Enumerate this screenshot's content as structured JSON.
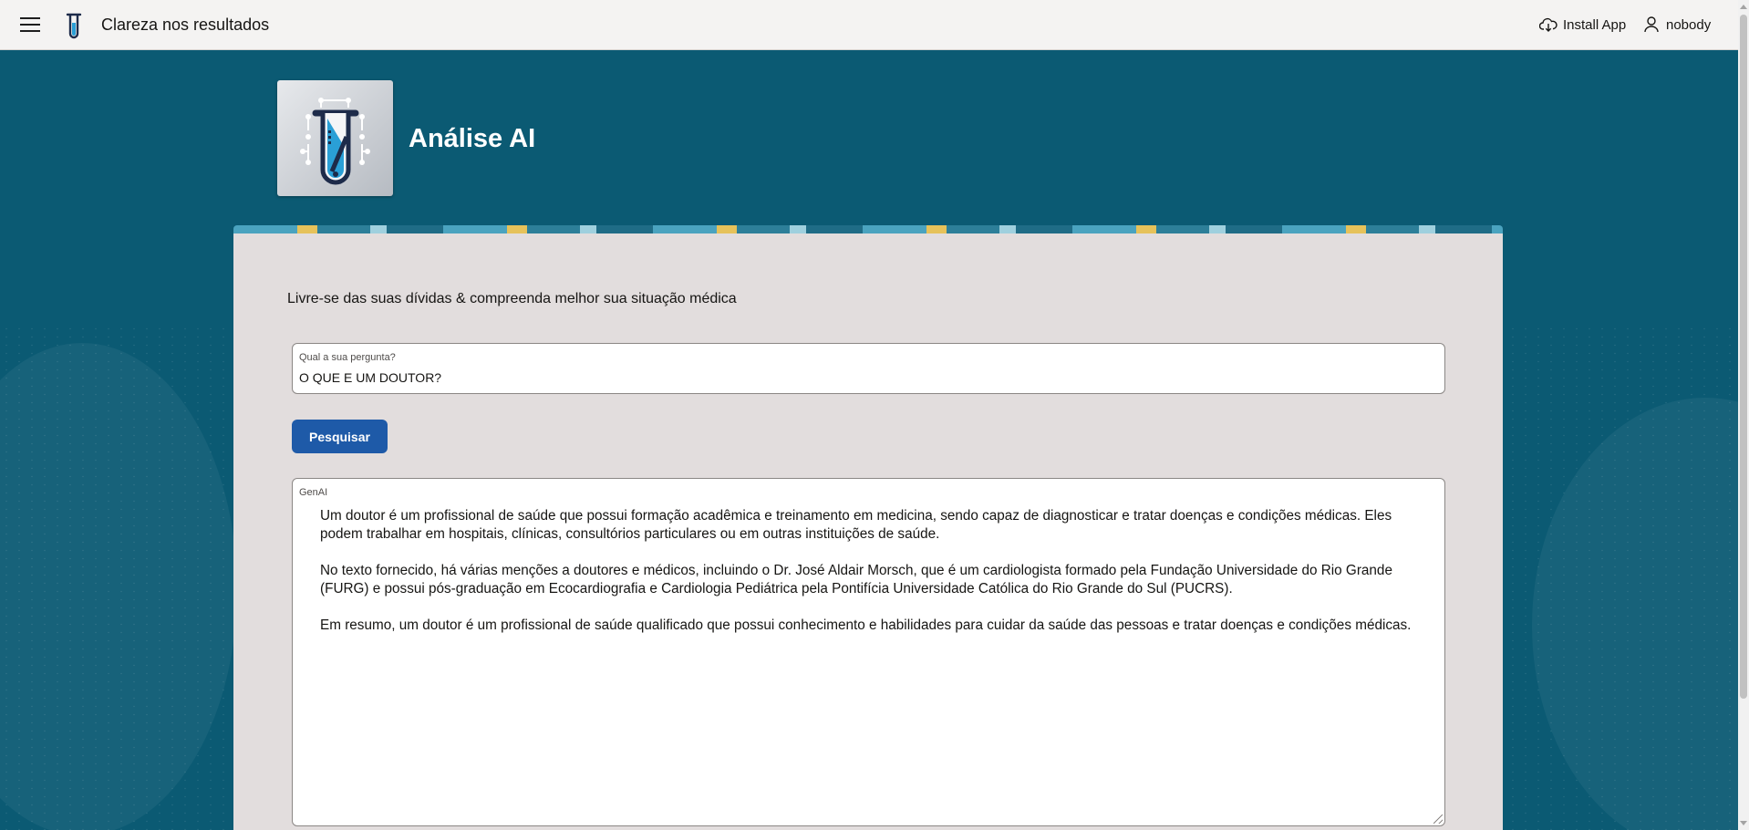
{
  "header": {
    "menu_icon": "hamburger-menu-icon",
    "logo_icon": "test-tube-icon",
    "title": "Clareza nos resultados",
    "install_icon": "cloud-download-icon",
    "install_label": "Install App",
    "user_icon": "user-icon",
    "username": "nobody"
  },
  "hero": {
    "logo_icon": "test-tube-circuit-logo",
    "title": "Análise AI"
  },
  "main": {
    "heading": "Livre-se das suas dívidas & compreenda melhor sua situação médica",
    "question_field": {
      "label": "Qual a sua pergunta?",
      "value": "O QUE E UM DOUTOR?"
    },
    "search_button_label": "Pesquisar",
    "answer_field": {
      "label": "GenAI",
      "paragraphs": [
        "Um doutor é um profissional de saúde que possui formação acadêmica e treinamento em medicina, sendo capaz de diagnosticar e tratar doenças e condições médicas. Eles podem trabalhar em hospitais, clínicas, consultórios particulares ou em outras instituições de saúde.",
        "No texto fornecido, há várias menções a doutores e médicos, incluindo o Dr. José Aldair Morsch, que é um cardiologista formado pela Fundação Universidade do Rio Grande (FURG) e possui pós-graduação em Ecocardiografia e Cardiologia Pediátrica pela Pontifícia Universidade Católica do Rio Grande do Sul (PUCRS).",
        "Em resumo, um doutor é um profissional de saúde qualificado que possui conhecimento e habilidades para cuidar da saúde das pessoas e tratar doenças e condições médicas."
      ]
    }
  },
  "colors": {
    "page_background": "#0b5a73",
    "topbar_background": "#f4f3f2",
    "card_background": "#e2dddd",
    "primary_button": "#1e5aa8"
  }
}
